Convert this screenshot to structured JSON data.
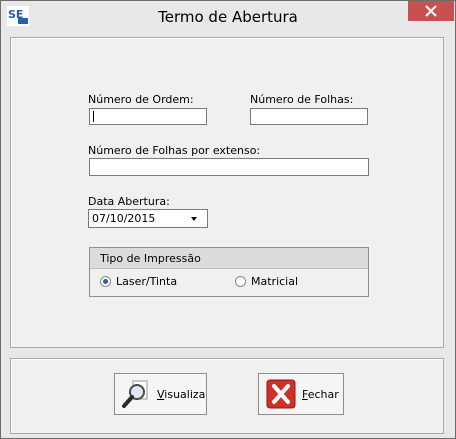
{
  "window": {
    "title": "Termo de Abertura",
    "app_icon": "app-logo-icon",
    "close_icon": "close-icon"
  },
  "form": {
    "numero_ordem_label": "Número de Ordem:",
    "numero_ordem_value": "",
    "numero_folhas_label": "Número de Folhas:",
    "numero_folhas_value": "",
    "folhas_extenso_label": "Número de Folhas por extenso:",
    "folhas_extenso_value": "",
    "data_abertura_label": "Data Abertura:",
    "data_abertura_value": "07/10/2015"
  },
  "tipo_impressao": {
    "title": "Tipo de Impressão",
    "options": [
      {
        "label": "Laser/Tinta",
        "selected": true
      },
      {
        "label": "Matricial",
        "selected": false
      }
    ]
  },
  "buttons": {
    "visualiza": {
      "mnemonic": "V",
      "rest": "isualiza",
      "icon": "magnifier-icon"
    },
    "fechar": {
      "mnemonic": "F",
      "rest": "echar",
      "icon": "red-x-icon"
    }
  },
  "colors": {
    "close_button": "#c75050",
    "radio_selected": "#2b5fb4",
    "fechar_icon": "#d0302a"
  }
}
